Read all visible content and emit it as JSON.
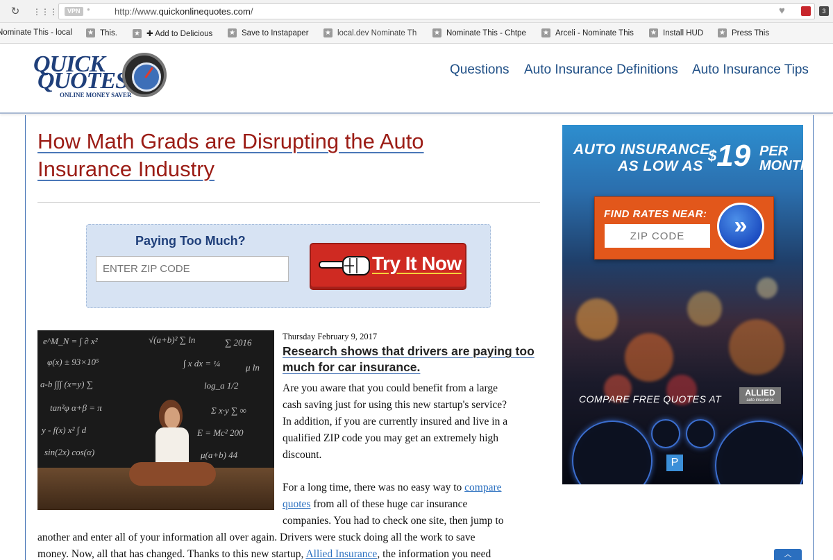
{
  "browser": {
    "vpn_label": "VPN",
    "url_prefix": "http://www.",
    "url_domain": "quickonlinequotes.com",
    "url_suffix": "/",
    "ext_badge": "3",
    "bookmarks": [
      "Nominate This - local",
      "This.",
      "✚ Add to Delicious",
      "Save to Instapaper",
      "local.dev Nominate Th",
      "Nominate This - Chtpe",
      "Arceli - Nominate This",
      "Install HUD",
      "Press This"
    ]
  },
  "header": {
    "logo_line1": "QUICK",
    "logo_line2": "QUOTES",
    "logo_tagline": "ONLINE MONEY SAVER",
    "nav": [
      "Questions",
      "Auto Insurance Definitions",
      "Auto Insurance Tips"
    ]
  },
  "article": {
    "title_line1": "How Math Grads are Disrupting the Auto",
    "title_line2": "Insurance Industry",
    "zip_prompt": "Paying Too Much?",
    "zip_placeholder": "ENTER ZIP CODE",
    "try_button": "Try It Now",
    "date": "Thursday February 9, 2017",
    "subhead_line1": "Research shows that drivers are paying too",
    "subhead_line2": "much for car insurance.",
    "para1": [
      "Are you aware that you could benefit from a large",
      "cash saving just for using this new startup's service?",
      "In addition, if you are currently insured and live in a",
      "qualified ZIP code you may get an extremely high",
      "discount."
    ],
    "para2_start": "For a long time, there was no easy way to ",
    "para2_link1": "compare",
    "para2_link1b": "quotes",
    "para2_after_link": " from all of these huge car insurance",
    "para2_line3": "companies. You had to check one site, then jump to",
    "para2_line4": "another and enter all of your information all over again. Drivers were stuck doing all the work to save",
    "para2_line5_start": "money. Now, all that has changed. Thanks to this new startup, ",
    "para2_link2": "Allied Insurance",
    "para2_line5_end": ", the information you need"
  },
  "ad": {
    "line1": "AUTO INSURANCE",
    "line2": "AS LOW AS",
    "price_symbol": "$",
    "price": "19",
    "per_line1": "PER",
    "per_line2": "MONTH",
    "form_label": "FIND RATES NEAR:",
    "zip_placeholder": "ZIP CODE",
    "go_symbol": "»",
    "compare_text": "COMPARE FREE QUOTES AT",
    "allied_logo": "ALLIED",
    "allied_sub": "auto insurance"
  },
  "colors": {
    "headline": "#9b1c15",
    "nav": "#1f4f86",
    "link": "#2a6fbf",
    "button": "#cf2a22",
    "ad_form": "#e2571b"
  }
}
